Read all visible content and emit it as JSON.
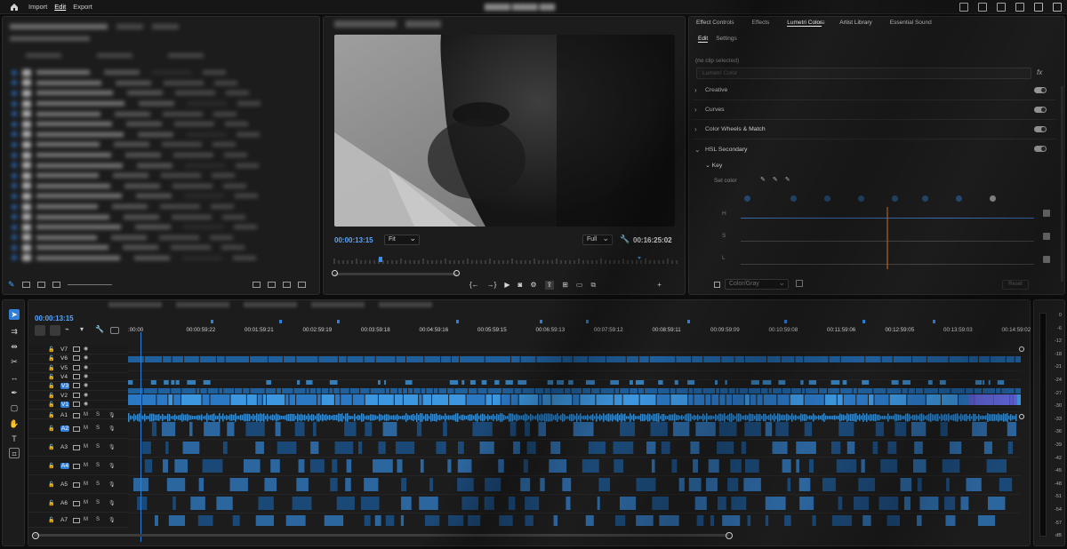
{
  "topbar": {
    "nav": [
      "Import",
      "Edit",
      "Export"
    ],
    "active": "Edit"
  },
  "program": {
    "timecode": "00:00:13:15",
    "zoom": "Fit",
    "resolution": "Full",
    "duration": "00:16:25:02"
  },
  "lumetri": {
    "tabs": [
      "Effect Controls",
      "Effects",
      "Lumetri Color",
      "Artist Library",
      "Essential Sound"
    ],
    "active_tab": "Lumetri Color",
    "subtabs": [
      "Edit",
      "Settings"
    ],
    "no_clip": "(no clip selected)",
    "select_placeholder": "Lumetri Color",
    "sections": [
      "Creative",
      "Curves",
      "Color Wheels & Match",
      "HSL Secondary"
    ],
    "key_label": "Key",
    "set_color": "Set color",
    "hsl_labels": [
      "H",
      "S",
      "L"
    ],
    "colorgray": "Color/Gray",
    "reset": "Reset"
  },
  "timeline": {
    "timecode": "00:00:13:15",
    "ruler": [
      ":00:00",
      "00:00:59:22",
      "00:01:59:21",
      "00:02:59:19",
      "00:03:59:18",
      "00:04:59:16",
      "00:05:59:15",
      "00:06:59:13",
      "00:07:59:12",
      "00:08:59:11",
      "00:09:59:09",
      "00:10:59:08",
      "00:11:59:06",
      "00:12:59:05",
      "00:13:59:03",
      "00:14:59:02"
    ],
    "video_tracks": [
      "V7",
      "V6",
      "V5",
      "V4",
      "V3",
      "V2",
      "V1"
    ],
    "audio_tracks": [
      "A1",
      "A2",
      "A3",
      "A4",
      "A5",
      "A6",
      "A7"
    ],
    "track_buttons": [
      "M",
      "S"
    ]
  },
  "meters": {
    "ticks": [
      "0",
      "-6",
      "-12",
      "-18",
      "-21",
      "-24",
      "-27",
      "-30",
      "-33",
      "-36",
      "-39",
      "-42",
      "-45",
      "-48",
      "-51",
      "-54",
      "-57",
      "dB"
    ]
  },
  "colors": {
    "accent": "#2f7fd8",
    "timecode": "#58a6ff",
    "panel": "#1c1c1c",
    "clip_video": "#1f5f9c",
    "clip_bright": "#3d97e0"
  }
}
